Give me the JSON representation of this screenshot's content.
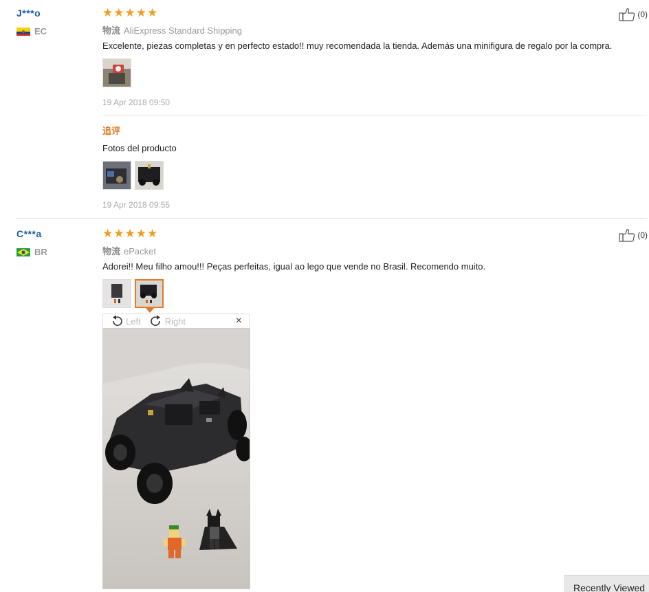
{
  "reviews": [
    {
      "user": "J***o",
      "country": "EC",
      "rating": 5,
      "shipping_label": "物流",
      "shipping_method": "AliExpress Standard Shipping",
      "text": "Excelente, piezas completas y en perfecto estado!! muy recomendada la tienda. Además una minifigura de regalo por la compra.",
      "date": "19 Apr 2018 09:50",
      "helpful_count": "(0)",
      "followup": {
        "title": "追评",
        "text": "Fotos del producto",
        "date": "19 Apr 2018 09:55"
      }
    },
    {
      "user": "C***a",
      "country": "BR",
      "rating": 5,
      "shipping_label": "物流",
      "shipping_method": "ePacket",
      "text": "Adorei!! Meu filho amou!!! Peças perfeitas, igual ao lego que vende no Brasil. Recomendo muito.",
      "helpful_count": "(0)"
    }
  ],
  "viewer": {
    "rotate_left": "Left",
    "rotate_right": "Right",
    "close": "×"
  },
  "recently_viewed": "Recently Viewed",
  "colors": {
    "username": "#1c5aa8",
    "star": "#f59b1c",
    "accent": "#e07b28"
  },
  "icons": [
    "thumbs-up-icon",
    "rotate-left-icon",
    "rotate-right-icon",
    "close-icon",
    "star-icon"
  ]
}
